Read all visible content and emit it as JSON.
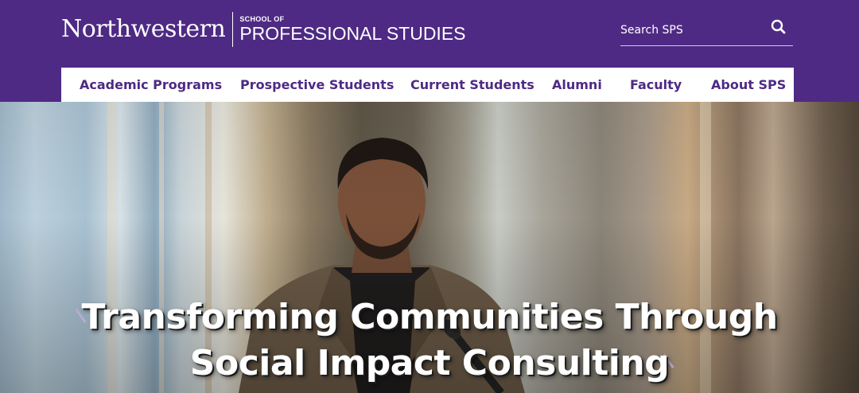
{
  "header": {
    "logo": {
      "wordmark": "Northwestern",
      "school_small": "SCHOOL OF",
      "school_large": "PROFESSIONAL STUDIES"
    },
    "search": {
      "placeholder": "Search SPS",
      "icon": "search-icon"
    },
    "brand_color": "#4e2a84"
  },
  "nav": {
    "items": [
      {
        "label": "Academic Programs"
      },
      {
        "label": "Prospective Students"
      },
      {
        "label": "Current Students"
      },
      {
        "label": "Alumni"
      },
      {
        "label": "Faculty"
      },
      {
        "label": "About SPS"
      }
    ]
  },
  "hero": {
    "title_line1": "Transforming Communities Through",
    "title_line2": "Social Impact Consulting",
    "accent_color": "#b6acd1"
  }
}
